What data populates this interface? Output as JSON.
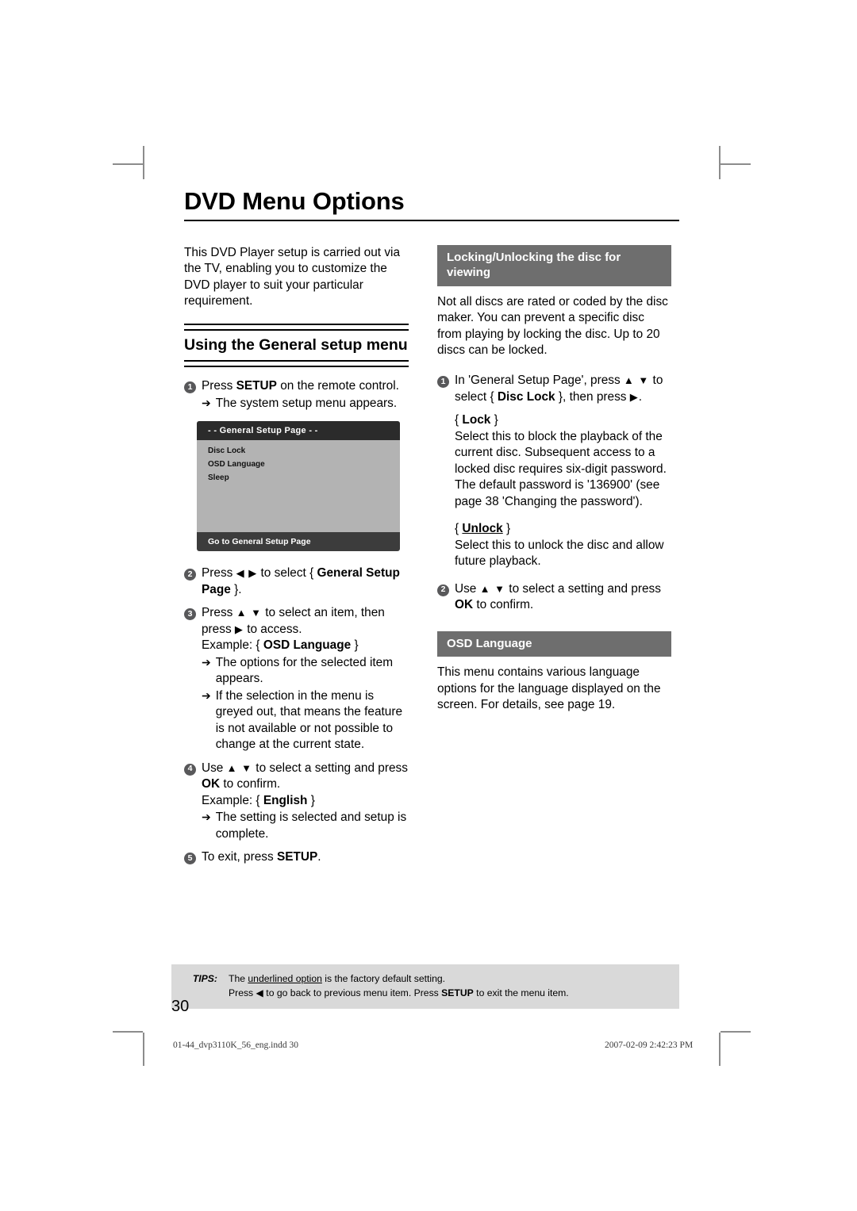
{
  "document": {
    "title": "DVD Menu Options",
    "page_number": "30"
  },
  "left_column": {
    "intro": "This DVD Player setup is carried out via the TV, enabling you to customize the DVD player to suit your particular requirement.",
    "section_heading": "Using the General setup menu",
    "step1": {
      "num": "1",
      "text_before": "Press ",
      "bold": "SETUP",
      "text_after": " on the remote control.",
      "sub_arrow": "➔",
      "sub": "The system setup menu appears."
    },
    "tv_screen": {
      "title": "- -  General Setup Page   - -",
      "items": [
        "Disc Lock",
        "OSD Language",
        "Sleep"
      ],
      "footer": "Go to General Setup Page"
    },
    "step2": {
      "num": "2",
      "text_before": "Press ",
      "icons": "◀ ▶",
      "text_mid": " to select { ",
      "bold": "General Setup Page",
      "text_after": " }."
    },
    "step3": {
      "num": "3",
      "text_before": "Press ",
      "icons": "▲ ▼",
      "text_mid": " to select an item, then press ",
      "icon2": "▶",
      "text_after": " to access.",
      "example_label": "Example: { ",
      "example_bold": "OSD Language",
      "example_after": " }",
      "sub_arrow": "➔",
      "sub1": "The options for the selected item appears.",
      "sub2": "If the selection in the menu is greyed out, that means the feature is not available or not possible to change at the current state."
    },
    "step4": {
      "num": "4",
      "text_before": "Use ",
      "icons": "▲ ▼",
      "text_mid": " to select a setting and press ",
      "bold": "OK",
      "text_after": " to confirm.",
      "example_label": "Example: { ",
      "example_bold": "English",
      "example_after": " }",
      "sub_arrow": "➔",
      "sub1": "The setting is selected and setup is complete."
    },
    "step5": {
      "num": "5",
      "text_before": "To exit, press ",
      "bold": "SETUP",
      "text_after": "."
    }
  },
  "right_column": {
    "lock_section": {
      "bar_title": "Locking/Unlocking the disc for viewing",
      "intro": "Not all discs are rated or coded by the disc maker. You can prevent a specific disc from playing by locking the disc. Up to 20 discs can be locked.",
      "step1": {
        "num": "1",
        "text_before": "In 'General Setup Page', press ",
        "icons": "▲ ▼",
        "text_mid": " to select { ",
        "bold": "Disc Lock",
        "text_mid2": " }, then press ",
        "icon2": "▶",
        "text_after": "."
      },
      "lock_label_open": "{ ",
      "lock_label_bold": "Lock",
      "lock_label_close": " }",
      "lock_text": "Select this to block the playback of the current disc. Subsequent access to a locked disc requires six-digit password. The default password is '136900' (see page 38 'Changing the password').",
      "unlock_label_open": "{ ",
      "unlock_label_bold": "Unlock",
      "unlock_label_close": " }",
      "unlock_text": "Select this to unlock the disc and allow future playback.",
      "step2": {
        "num": "2",
        "text_before": "Use ",
        "icons": "▲ ▼",
        "text_mid": " to select a setting and press ",
        "bold": "OK",
        "text_after": " to confirm."
      }
    },
    "osd_section": {
      "bar_title": "OSD Language",
      "text": "This menu contains various language options for the language displayed on the screen. For details, see page 19."
    }
  },
  "tips": {
    "label": "TIPS:",
    "line1_before": "The ",
    "line1_underline": "underlined option",
    "line1_after": " is the factory default setting.",
    "line2_before": "Press ",
    "line2_icon": "◀",
    "line2_mid": " to go back to previous menu item. Press ",
    "line2_bold": "SETUP",
    "line2_after": " to exit the menu item."
  },
  "print_footer": {
    "file": "01-44_dvp3110K_56_eng.indd   30",
    "timestamp": "2007-02-09   2:42:23 PM"
  },
  "colors": {
    "bar_gray": "#6e6e6e",
    "tips_gray": "#d9d9d9",
    "bullet_gray": "#58585a",
    "tv_body": "#b3b3b3",
    "tv_header": "#2b2b2b",
    "tv_footer": "#3c3c3c"
  }
}
